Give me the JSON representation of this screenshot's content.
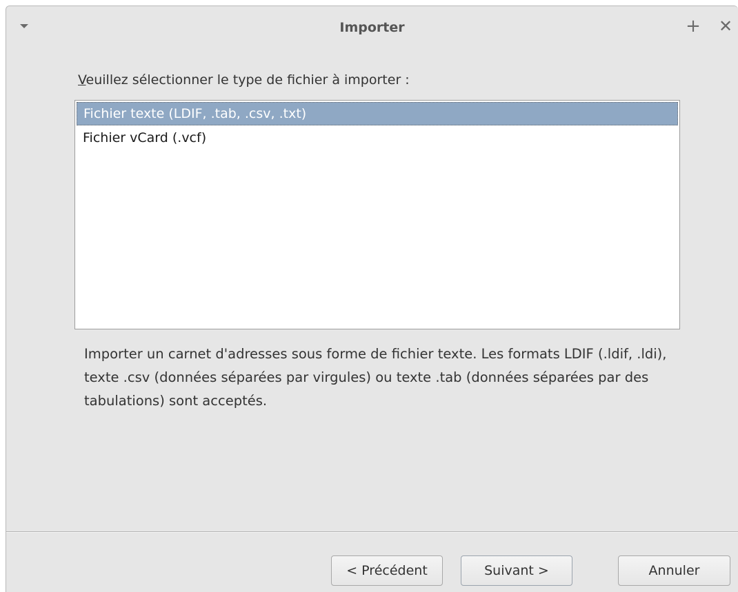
{
  "window": {
    "title": "Importer",
    "menu_icon": "chevron-down-icon",
    "maximize_glyph": "+",
    "close_glyph": "✕"
  },
  "prompt": {
    "mnemonic": "V",
    "rest": "euillez sélectionner le type de fichier à importer :"
  },
  "file_types": [
    {
      "label": "Fichier texte (LDIF, .tab, .csv, .txt)",
      "selected": true
    },
    {
      "label": "Fichier vCard (.vcf)",
      "selected": false
    }
  ],
  "description": "Importer un carnet d'adresses sous forme de fichier texte. Les formats LDIF (.ldif, .ldi), texte .csv (données séparées par virgules) ou texte .tab (données séparées par des tabulations) sont acceptés.",
  "buttons": {
    "previous": "< Précédent",
    "next": "Suivant >",
    "cancel": "Annuler"
  },
  "colors": {
    "selection": "#8fa8c4",
    "window_bg": "#e6e6e6"
  }
}
